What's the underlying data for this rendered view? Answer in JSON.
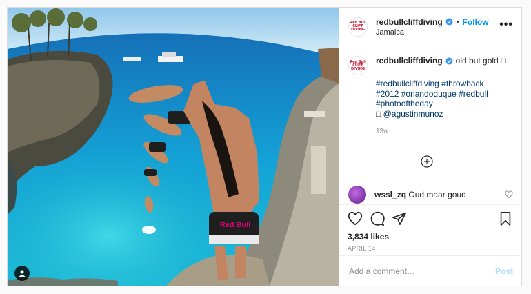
{
  "post": {
    "username": "redbullcliffdiving",
    "location": "Jamaica",
    "follow_label": "Follow",
    "separator": "•",
    "more_label": "•••",
    "avatar_text": "Red Bull CLIFF DIVING",
    "caption": {
      "text": "old but gold",
      "trailing_glyph": "□",
      "hashtags": "#redbullcliffdiving #throwback\n#2012 #orlandoduque #redbull\n#photooftheday",
      "mention_prefix": "□",
      "mention": "@agustinmunoz",
      "time_ago": "13w"
    },
    "comment": {
      "username": "wssl_zq",
      "text": "Oud maar goud"
    },
    "likes": "3,834 likes",
    "date": "APRIL 14",
    "add_comment_placeholder": "Add a comment…",
    "post_label": "Post",
    "image_logo_text": "Red Bull"
  },
  "icons": {
    "verified": "verified-badge-icon",
    "more": "more-options-icon",
    "load_more": "plus-circle-icon",
    "heart": "heart-icon",
    "comment": "comment-icon",
    "share": "share-icon",
    "save": "bookmark-icon",
    "user_tag": "user-icon"
  },
  "colors": {
    "accent": "#0095f6",
    "post_disabled": "#b2dffc",
    "muted": "#8e8e8e",
    "link": "#00376b"
  }
}
